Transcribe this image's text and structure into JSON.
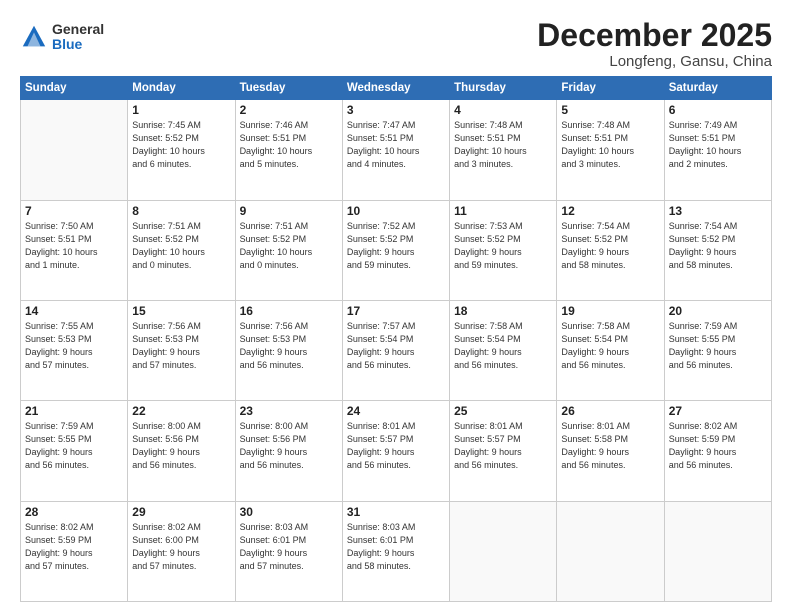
{
  "header": {
    "logo": {
      "general": "General",
      "blue": "Blue"
    },
    "title": "December 2025",
    "location": "Longfeng, Gansu, China"
  },
  "days_of_week": [
    "Sunday",
    "Monday",
    "Tuesday",
    "Wednesday",
    "Thursday",
    "Friday",
    "Saturday"
  ],
  "weeks": [
    [
      {
        "day": "",
        "info": ""
      },
      {
        "day": "1",
        "info": "Sunrise: 7:45 AM\nSunset: 5:52 PM\nDaylight: 10 hours\nand 6 minutes."
      },
      {
        "day": "2",
        "info": "Sunrise: 7:46 AM\nSunset: 5:51 PM\nDaylight: 10 hours\nand 5 minutes."
      },
      {
        "day": "3",
        "info": "Sunrise: 7:47 AM\nSunset: 5:51 PM\nDaylight: 10 hours\nand 4 minutes."
      },
      {
        "day": "4",
        "info": "Sunrise: 7:48 AM\nSunset: 5:51 PM\nDaylight: 10 hours\nand 3 minutes."
      },
      {
        "day": "5",
        "info": "Sunrise: 7:48 AM\nSunset: 5:51 PM\nDaylight: 10 hours\nand 3 minutes."
      },
      {
        "day": "6",
        "info": "Sunrise: 7:49 AM\nSunset: 5:51 PM\nDaylight: 10 hours\nand 2 minutes."
      }
    ],
    [
      {
        "day": "7",
        "info": "Sunrise: 7:50 AM\nSunset: 5:51 PM\nDaylight: 10 hours\nand 1 minute."
      },
      {
        "day": "8",
        "info": "Sunrise: 7:51 AM\nSunset: 5:52 PM\nDaylight: 10 hours\nand 0 minutes."
      },
      {
        "day": "9",
        "info": "Sunrise: 7:51 AM\nSunset: 5:52 PM\nDaylight: 10 hours\nand 0 minutes."
      },
      {
        "day": "10",
        "info": "Sunrise: 7:52 AM\nSunset: 5:52 PM\nDaylight: 9 hours\nand 59 minutes."
      },
      {
        "day": "11",
        "info": "Sunrise: 7:53 AM\nSunset: 5:52 PM\nDaylight: 9 hours\nand 59 minutes."
      },
      {
        "day": "12",
        "info": "Sunrise: 7:54 AM\nSunset: 5:52 PM\nDaylight: 9 hours\nand 58 minutes."
      },
      {
        "day": "13",
        "info": "Sunrise: 7:54 AM\nSunset: 5:52 PM\nDaylight: 9 hours\nand 58 minutes."
      }
    ],
    [
      {
        "day": "14",
        "info": "Sunrise: 7:55 AM\nSunset: 5:53 PM\nDaylight: 9 hours\nand 57 minutes."
      },
      {
        "day": "15",
        "info": "Sunrise: 7:56 AM\nSunset: 5:53 PM\nDaylight: 9 hours\nand 57 minutes."
      },
      {
        "day": "16",
        "info": "Sunrise: 7:56 AM\nSunset: 5:53 PM\nDaylight: 9 hours\nand 56 minutes."
      },
      {
        "day": "17",
        "info": "Sunrise: 7:57 AM\nSunset: 5:54 PM\nDaylight: 9 hours\nand 56 minutes."
      },
      {
        "day": "18",
        "info": "Sunrise: 7:58 AM\nSunset: 5:54 PM\nDaylight: 9 hours\nand 56 minutes."
      },
      {
        "day": "19",
        "info": "Sunrise: 7:58 AM\nSunset: 5:54 PM\nDaylight: 9 hours\nand 56 minutes."
      },
      {
        "day": "20",
        "info": "Sunrise: 7:59 AM\nSunset: 5:55 PM\nDaylight: 9 hours\nand 56 minutes."
      }
    ],
    [
      {
        "day": "21",
        "info": "Sunrise: 7:59 AM\nSunset: 5:55 PM\nDaylight: 9 hours\nand 56 minutes."
      },
      {
        "day": "22",
        "info": "Sunrise: 8:00 AM\nSunset: 5:56 PM\nDaylight: 9 hours\nand 56 minutes."
      },
      {
        "day": "23",
        "info": "Sunrise: 8:00 AM\nSunset: 5:56 PM\nDaylight: 9 hours\nand 56 minutes."
      },
      {
        "day": "24",
        "info": "Sunrise: 8:01 AM\nSunset: 5:57 PM\nDaylight: 9 hours\nand 56 minutes."
      },
      {
        "day": "25",
        "info": "Sunrise: 8:01 AM\nSunset: 5:57 PM\nDaylight: 9 hours\nand 56 minutes."
      },
      {
        "day": "26",
        "info": "Sunrise: 8:01 AM\nSunset: 5:58 PM\nDaylight: 9 hours\nand 56 minutes."
      },
      {
        "day": "27",
        "info": "Sunrise: 8:02 AM\nSunset: 5:59 PM\nDaylight: 9 hours\nand 56 minutes."
      }
    ],
    [
      {
        "day": "28",
        "info": "Sunrise: 8:02 AM\nSunset: 5:59 PM\nDaylight: 9 hours\nand 57 minutes."
      },
      {
        "day": "29",
        "info": "Sunrise: 8:02 AM\nSunset: 6:00 PM\nDaylight: 9 hours\nand 57 minutes."
      },
      {
        "day": "30",
        "info": "Sunrise: 8:03 AM\nSunset: 6:01 PM\nDaylight: 9 hours\nand 57 minutes."
      },
      {
        "day": "31",
        "info": "Sunrise: 8:03 AM\nSunset: 6:01 PM\nDaylight: 9 hours\nand 58 minutes."
      },
      {
        "day": "",
        "info": ""
      },
      {
        "day": "",
        "info": ""
      },
      {
        "day": "",
        "info": ""
      }
    ]
  ]
}
